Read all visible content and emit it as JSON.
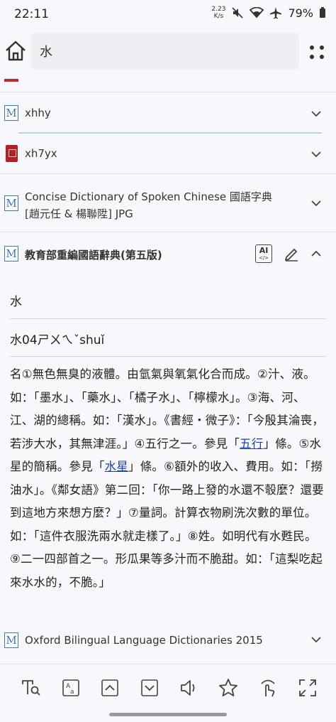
{
  "status": {
    "time": "22:11",
    "net_speed_value": "2.23",
    "net_speed_unit": "K/s",
    "battery": "79%"
  },
  "search": {
    "query": "水"
  },
  "dictionaries": [
    {
      "name": "xhhy",
      "icon": "m-icon"
    },
    {
      "name": "xh7yx",
      "icon": "red-book-icon"
    },
    {
      "name_line1": "Concise Dictionary of Spoken Chinese 國語字典",
      "name_line2": "[趙元任 & 楊聯陞] JPG",
      "icon": "m-icon"
    }
  ],
  "entry": {
    "dictionary": "教育部重編國語辭典(第五版)",
    "headword": "水",
    "pronunciation": "水04ㄕㄨㄟˇshuǐ",
    "definitions": {
      "p1": "名①無色無臭的液體。由氫氣與氧氣化合而成。②汁、液。如：「墨水」、「藥水」、「橘子水」、「檸檬水」。③海、河、江、湖的總稱。如：「漢水」。《書經・微子》：「今殷其淪喪，若涉大水，其無津涯。」④五行之一。參見「",
      "link1": "五行",
      "p2": "」條。⑤水星的簡稱。參見「",
      "link2": "水星",
      "p3": "」條。⑥額外的收入、費用。如：「撈油水」。《鄰女語》第二回：「你一路上發的水還不彀麼？還要到這地方來想方麼？」⑦量詞。計算衣物刷洗次數的單位。如：「這件衣服洗兩水就走樣了。」⑧姓。如明代有水甦民。⑨二一四部首之一。形瓜果等多汁而不脆甜。如：「這梨吃起來水水的，不脆。」"
    }
  },
  "next_dictionary": {
    "name": "Oxford Bilingual Language Dictionaries 2015",
    "icon": "m-icon"
  },
  "entry_actions": {
    "ai_label": "AI",
    "ai_sub": "</>"
  },
  "toolbar": [
    "text-search-icon",
    "translate-icon",
    "previous-entry-icon",
    "next-entry-icon",
    "speaker-icon",
    "favorite-star-icon",
    "tap-lookup-icon",
    "fullscreen-icon"
  ],
  "colors": {
    "accent_blue": "#3d74c4",
    "link_blue": "#1a3fb8",
    "book_red": "#b51f24"
  }
}
